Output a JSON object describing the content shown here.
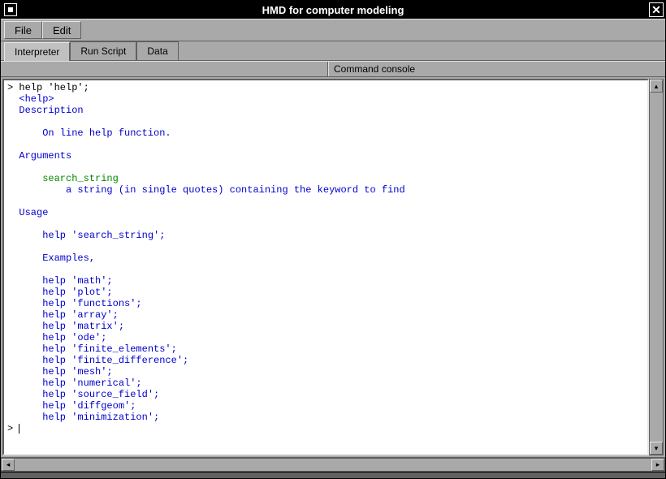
{
  "window": {
    "title": "HMD for computer modeling"
  },
  "menubar": {
    "items": [
      {
        "label": "File"
      },
      {
        "label": "Edit"
      }
    ]
  },
  "tabs": {
    "items": [
      {
        "label": "Interpreter",
        "active": true
      },
      {
        "label": "Run Script",
        "active": false
      },
      {
        "label": "Data",
        "active": false
      }
    ]
  },
  "panel_label": "Command console",
  "console": {
    "lines": [
      {
        "cls": "black",
        "text": "> help 'help';"
      },
      {
        "cls": "blue",
        "text": "  <help>"
      },
      {
        "cls": "blue",
        "text": "  Description"
      },
      {
        "cls": "blue",
        "text": ""
      },
      {
        "cls": "blue",
        "text": "      On line help function."
      },
      {
        "cls": "blue",
        "text": ""
      },
      {
        "cls": "blue",
        "text": "  Arguments"
      },
      {
        "cls": "blue",
        "text": ""
      },
      {
        "cls": "green",
        "text": "      search_string"
      },
      {
        "cls": "blue",
        "text": "          a string (in single quotes) containing the keyword to find"
      },
      {
        "cls": "blue",
        "text": ""
      },
      {
        "cls": "blue",
        "text": "  Usage"
      },
      {
        "cls": "blue",
        "text": ""
      },
      {
        "cls": "blue",
        "text": "      help 'search_string';"
      },
      {
        "cls": "blue",
        "text": ""
      },
      {
        "cls": "blue",
        "text": "      Examples,"
      },
      {
        "cls": "blue",
        "text": ""
      },
      {
        "cls": "blue",
        "text": "      help 'math';"
      },
      {
        "cls": "blue",
        "text": "      help 'plot';"
      },
      {
        "cls": "blue",
        "text": "      help 'functions';"
      },
      {
        "cls": "blue",
        "text": "      help 'array';"
      },
      {
        "cls": "blue",
        "text": "      help 'matrix';"
      },
      {
        "cls": "blue",
        "text": "      help 'ode';"
      },
      {
        "cls": "blue",
        "text": "      help 'finite_elements';"
      },
      {
        "cls": "blue",
        "text": "      help 'finite_difference';"
      },
      {
        "cls": "blue",
        "text": "      help 'mesh';"
      },
      {
        "cls": "blue",
        "text": "      help 'numerical';"
      },
      {
        "cls": "blue",
        "text": "      help 'source_field';"
      },
      {
        "cls": "blue",
        "text": "      help 'diffgeom';"
      },
      {
        "cls": "blue",
        "text": "      help 'minimization';"
      }
    ],
    "prompt": "> "
  },
  "glyphs": {
    "close": "✕",
    "up": "▴",
    "down": "▾",
    "left": "◂",
    "right": "▸"
  }
}
